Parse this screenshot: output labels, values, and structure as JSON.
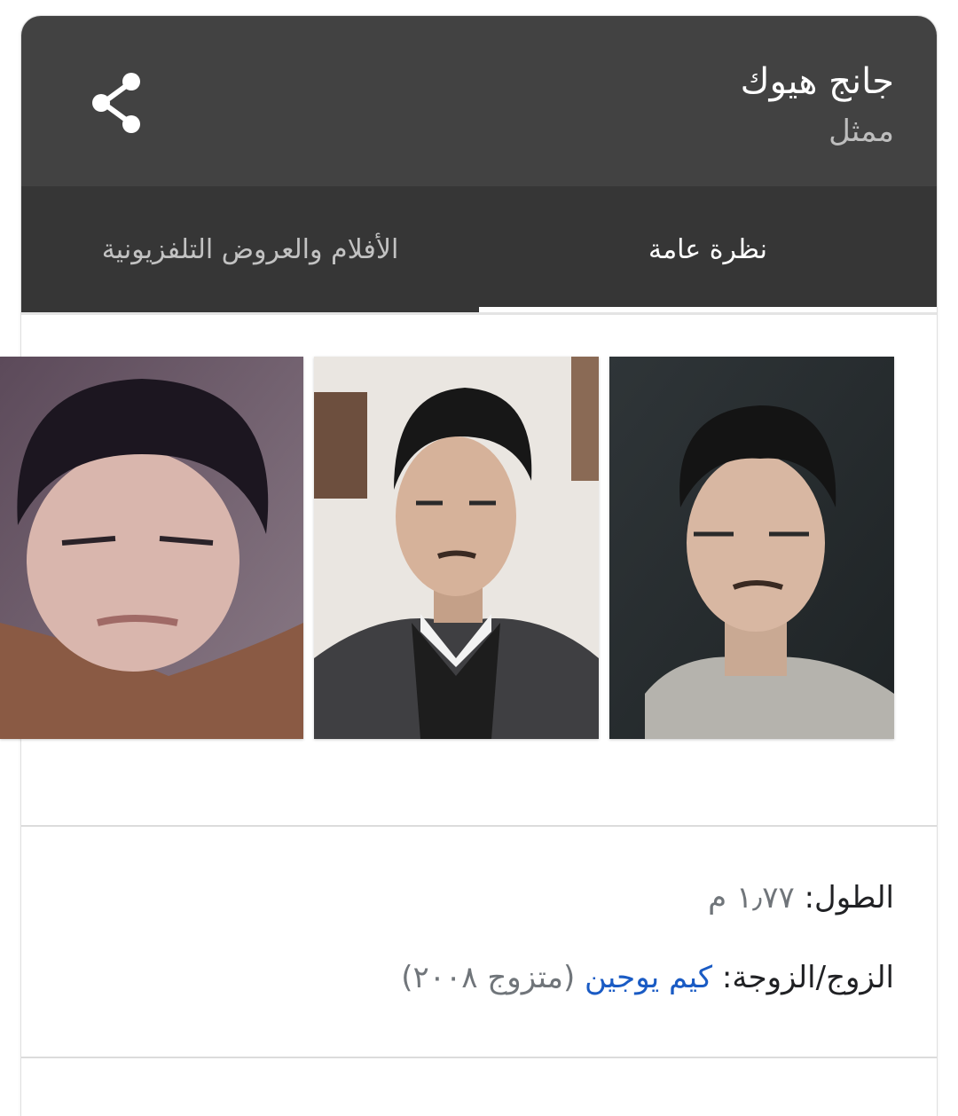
{
  "header": {
    "title": "جانج هيوك",
    "subtitle": "ممثل",
    "share_icon": "share-icon"
  },
  "tabs": [
    {
      "label": "نظرة عامة",
      "active": true
    },
    {
      "label": "الأفلام والعروض التلفزيونية",
      "active": false
    }
  ],
  "images": [
    {
      "label": "photo-1"
    },
    {
      "label": "photo-2"
    },
    {
      "label": "photo-3"
    }
  ],
  "facts": {
    "height": {
      "label": "الطول:",
      "value": "١٫٧٧ م"
    },
    "spouse": {
      "label": "الزوج/الزوجة:",
      "link": "كيم يوجين",
      "extra": "(متزوج ٢٠٠٨)"
    }
  },
  "colors": {
    "header_bg": "#424242",
    "tabs_bg": "#363636",
    "link": "#1a5bc4"
  }
}
